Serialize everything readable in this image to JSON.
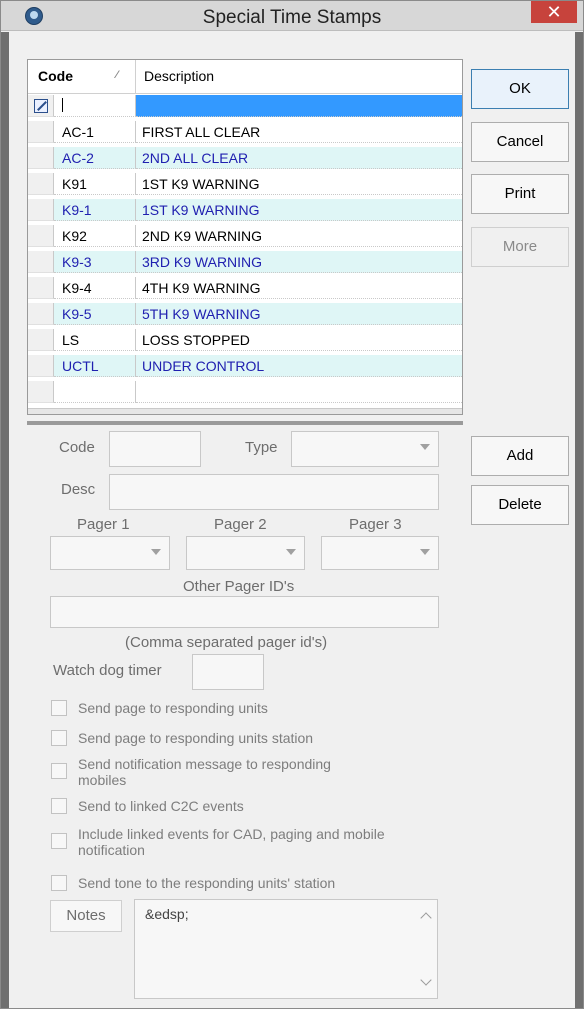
{
  "window": {
    "title": "Special Time Stamps",
    "close_glyph": "✕",
    "icon": "app-globe-icon"
  },
  "grid": {
    "columns": {
      "code": "Code",
      "description": "Description",
      "sort_glyph": "⁄"
    },
    "rows": [
      {
        "code": "AC-1",
        "description": "FIRST ALL CLEAR"
      },
      {
        "code": "AC-2",
        "description": "2ND ALL CLEAR"
      },
      {
        "code": "K91",
        "description": "1ST K9 WARNING"
      },
      {
        "code": "K9-1",
        "description": "1ST K9 WARNING"
      },
      {
        "code": "K92",
        "description": "2ND K9 WARNING"
      },
      {
        "code": "K9-3",
        "description": "3RD K9 WARNING"
      },
      {
        "code": "K9-4",
        "description": "4TH K9 WARNING"
      },
      {
        "code": "K9-5",
        "description": "5TH K9 WARNING"
      },
      {
        "code": "LS",
        "description": "LOSS STOPPED"
      },
      {
        "code": "UCTL",
        "description": "UNDER CONTROL"
      }
    ]
  },
  "buttons": {
    "ok": "OK",
    "cancel": "Cancel",
    "print": "Print",
    "more": "More",
    "add": "Add",
    "delete": "Delete"
  },
  "form": {
    "code_label": "Code",
    "type_label": "Type",
    "desc_label": "Desc",
    "pager1_label": "Pager 1",
    "pager2_label": "Pager 2",
    "pager3_label": "Pager 3",
    "other_pager_label": "Other Pager ID's",
    "other_pager_hint": "(Comma separated pager id's)",
    "watchdog_label": "Watch dog timer",
    "checkboxes": [
      "Send page to responding units",
      "Send page to responding units station",
      "Send notification message to responding mobiles",
      "Send to linked C2C events",
      "Include linked events for CAD, paging and mobile notification",
      "Send tone to the responding units' station"
    ],
    "notes_label": "Notes",
    "notes_value": "&edsp;"
  },
  "colors": {
    "accent": "#3399ff",
    "alt_row": "#dff6f6",
    "alt_text": "#2020b0",
    "close": "#c7433c"
  }
}
